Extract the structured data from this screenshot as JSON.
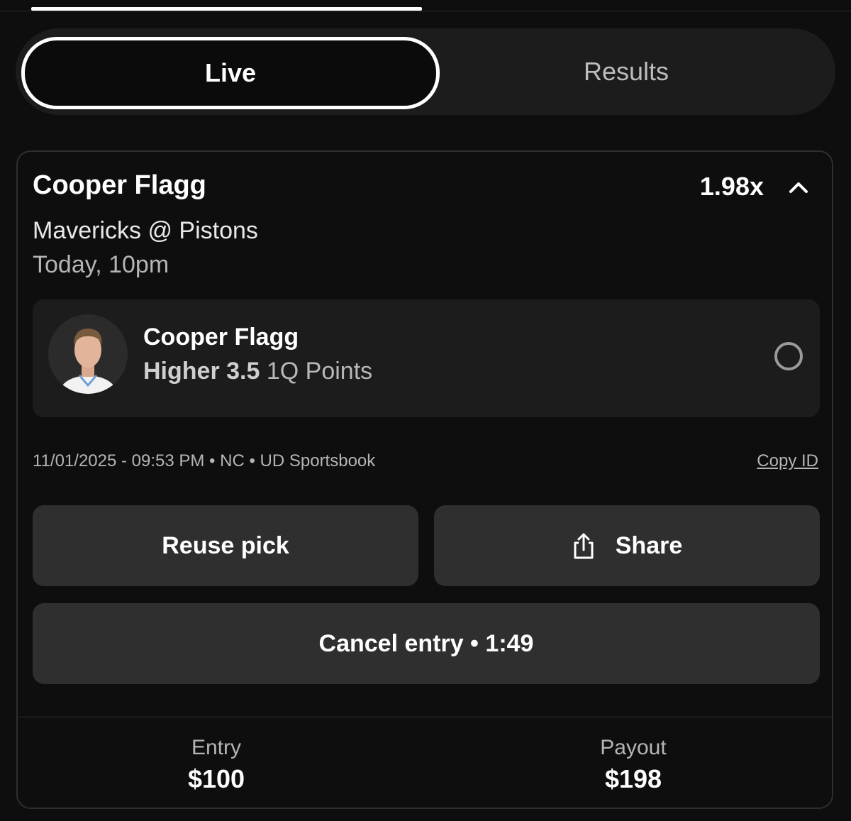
{
  "tabs": {
    "live": "Live",
    "results": "Results"
  },
  "card": {
    "player": "Cooper Flagg",
    "multiplier": "1.98x",
    "matchup": "Mavericks @ Pistons",
    "game_time": "Today, 10pm",
    "pick": {
      "player": "Cooper Flagg",
      "direction": "Higher 3.5",
      "stat": "1Q Points"
    },
    "meta": "11/01/2025 - 09:53 PM • NC • UD Sportsbook",
    "copy_id": "Copy ID",
    "buttons": {
      "reuse": "Reuse pick",
      "share": "Share",
      "cancel": "Cancel entry • 1:49"
    },
    "summary": {
      "entry_label": "Entry",
      "entry_value": "$100",
      "payout_label": "Payout",
      "payout_value": "$198"
    }
  },
  "icons": {
    "expand": "chevron-up-icon",
    "share": "share-icon",
    "status": "pending-circle-icon",
    "avatar": "player-avatar"
  },
  "colors": {
    "background": "#0e0e0e",
    "surface": "#1c1c1c",
    "button": "#2f2f2f",
    "text_primary": "#ffffff",
    "text_secondary": "#b5b5b5"
  }
}
